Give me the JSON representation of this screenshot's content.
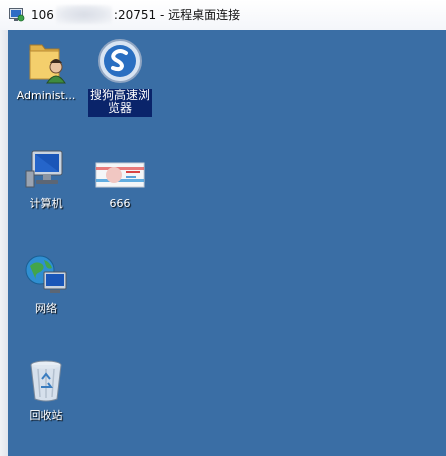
{
  "window": {
    "title_prefix": "106",
    "title_suffix": ":20751 - 远程桌面连接",
    "icon": "remote-desktop-icon"
  },
  "desktop": {
    "background_color": "#3a6ea5",
    "icons": [
      {
        "label": "Administ...",
        "icon": "user-folder-icon"
      },
      {
        "label": "搜狗高速浏览器",
        "icon": "sogou-browser-icon",
        "selected": true
      },
      {
        "label": "计算机",
        "icon": "computer-icon"
      },
      {
        "label": "666",
        "icon": "image-file-icon"
      },
      {
        "label": "网络",
        "icon": "network-icon"
      },
      {
        "label": "回收站",
        "icon": "recycle-bin-icon"
      }
    ]
  }
}
